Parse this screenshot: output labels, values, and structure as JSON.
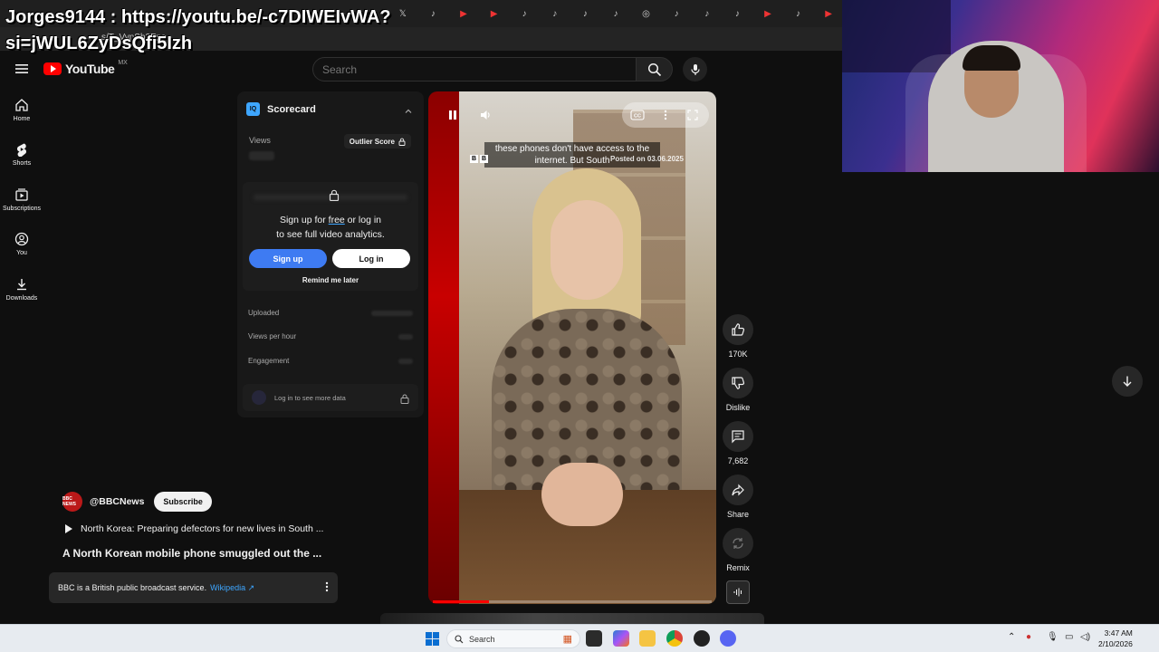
{
  "stream_overlay": {
    "line1": "Jorges9144 : https://youtu.be/-c7DIWEIvWA?",
    "line2": "si=jWUL6ZyDsQfi5Izh",
    "small_url": "s/T_VynSh2Fpo"
  },
  "youtube": {
    "logo_text": "YouTube",
    "country_code": "MX",
    "search_placeholder": "Search"
  },
  "nav": {
    "items": [
      {
        "label": "Home",
        "icon": "home-icon"
      },
      {
        "label": "Shorts",
        "icon": "shorts-icon"
      },
      {
        "label": "Subscriptions",
        "icon": "subscriptions-icon"
      },
      {
        "label": "You",
        "icon": "user-icon"
      },
      {
        "label": "Downloads",
        "icon": "download-icon"
      }
    ]
  },
  "scorecard": {
    "logo": "IQ",
    "title": "Scorecard",
    "views_label": "Views",
    "outlier_label": "Outlier Score",
    "gate_line1_pre": "Sign up for ",
    "gate_line1_free": "free",
    "gate_line1_post": " or log in",
    "gate_line2": "to see full video analytics.",
    "signup_label": "Sign up",
    "login_label": "Log in",
    "remind_label": "Remind me later",
    "rows": [
      "Uploaded",
      "Views per hour",
      "Engagement"
    ],
    "more_label": "Log in to see more data"
  },
  "video": {
    "caption_line1": "these phones don't have access to the",
    "caption_line2": "internet. But South",
    "bbc_letters": [
      "B",
      "B"
    ],
    "posted": "Posted on 03.06.2025",
    "progress_fraction": 0.2
  },
  "actions": {
    "like_count": "170K",
    "dislike_label": "Dislike",
    "comments_count": "7,682",
    "share_label": "Share",
    "remix_label": "Remix"
  },
  "channel": {
    "handle": "@BBCNews",
    "avatar_text": "BBC NEWS",
    "subscribe_label": "Subscribe",
    "playlist_title": "North Korea: Preparing defectors for new lives in South ...",
    "video_title": "A North Korean mobile phone smuggled out the ...",
    "info_text": "BBC is a British public broadcast service.",
    "info_link": "Wikipedia"
  },
  "taskbar": {
    "search_label": "Search",
    "time": "3:47 AM",
    "date": "2/10/2026"
  },
  "colors": {
    "accent_blue": "#3e7bf2",
    "link_blue": "#3ea6ff",
    "youtube_red": "#ff0000",
    "bbc_red": "#bb1919"
  }
}
